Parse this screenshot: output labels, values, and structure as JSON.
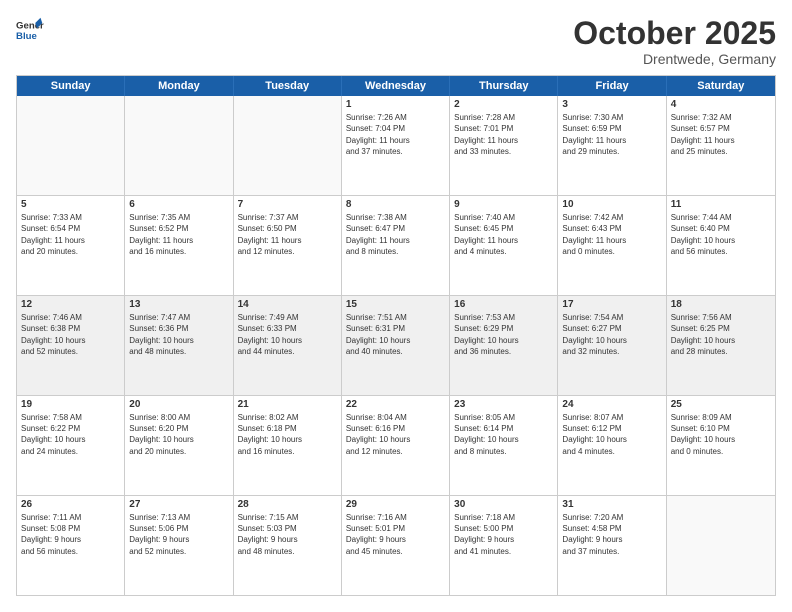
{
  "logo": {
    "line1": "General",
    "line2": "Blue"
  },
  "title": "October 2025",
  "subtitle": "Drentwede, Germany",
  "days": [
    "Sunday",
    "Monday",
    "Tuesday",
    "Wednesday",
    "Thursday",
    "Friday",
    "Saturday"
  ],
  "rows": [
    [
      {
        "day": "",
        "text": "",
        "empty": true
      },
      {
        "day": "",
        "text": "",
        "empty": true
      },
      {
        "day": "",
        "text": "",
        "empty": true
      },
      {
        "day": "1",
        "text": "Sunrise: 7:26 AM\nSunset: 7:04 PM\nDaylight: 11 hours\nand 37 minutes."
      },
      {
        "day": "2",
        "text": "Sunrise: 7:28 AM\nSunset: 7:01 PM\nDaylight: 11 hours\nand 33 minutes."
      },
      {
        "day": "3",
        "text": "Sunrise: 7:30 AM\nSunset: 6:59 PM\nDaylight: 11 hours\nand 29 minutes."
      },
      {
        "day": "4",
        "text": "Sunrise: 7:32 AM\nSunset: 6:57 PM\nDaylight: 11 hours\nand 25 minutes."
      }
    ],
    [
      {
        "day": "5",
        "text": "Sunrise: 7:33 AM\nSunset: 6:54 PM\nDaylight: 11 hours\nand 20 minutes."
      },
      {
        "day": "6",
        "text": "Sunrise: 7:35 AM\nSunset: 6:52 PM\nDaylight: 11 hours\nand 16 minutes."
      },
      {
        "day": "7",
        "text": "Sunrise: 7:37 AM\nSunset: 6:50 PM\nDaylight: 11 hours\nand 12 minutes."
      },
      {
        "day": "8",
        "text": "Sunrise: 7:38 AM\nSunset: 6:47 PM\nDaylight: 11 hours\nand 8 minutes."
      },
      {
        "day": "9",
        "text": "Sunrise: 7:40 AM\nSunset: 6:45 PM\nDaylight: 11 hours\nand 4 minutes."
      },
      {
        "day": "10",
        "text": "Sunrise: 7:42 AM\nSunset: 6:43 PM\nDaylight: 11 hours\nand 0 minutes."
      },
      {
        "day": "11",
        "text": "Sunrise: 7:44 AM\nSunset: 6:40 PM\nDaylight: 10 hours\nand 56 minutes."
      }
    ],
    [
      {
        "day": "12",
        "text": "Sunrise: 7:46 AM\nSunset: 6:38 PM\nDaylight: 10 hours\nand 52 minutes.",
        "shaded": true
      },
      {
        "day": "13",
        "text": "Sunrise: 7:47 AM\nSunset: 6:36 PM\nDaylight: 10 hours\nand 48 minutes.",
        "shaded": true
      },
      {
        "day": "14",
        "text": "Sunrise: 7:49 AM\nSunset: 6:33 PM\nDaylight: 10 hours\nand 44 minutes.",
        "shaded": true
      },
      {
        "day": "15",
        "text": "Sunrise: 7:51 AM\nSunset: 6:31 PM\nDaylight: 10 hours\nand 40 minutes.",
        "shaded": true
      },
      {
        "day": "16",
        "text": "Sunrise: 7:53 AM\nSunset: 6:29 PM\nDaylight: 10 hours\nand 36 minutes.",
        "shaded": true
      },
      {
        "day": "17",
        "text": "Sunrise: 7:54 AM\nSunset: 6:27 PM\nDaylight: 10 hours\nand 32 minutes.",
        "shaded": true
      },
      {
        "day": "18",
        "text": "Sunrise: 7:56 AM\nSunset: 6:25 PM\nDaylight: 10 hours\nand 28 minutes.",
        "shaded": true
      }
    ],
    [
      {
        "day": "19",
        "text": "Sunrise: 7:58 AM\nSunset: 6:22 PM\nDaylight: 10 hours\nand 24 minutes."
      },
      {
        "day": "20",
        "text": "Sunrise: 8:00 AM\nSunset: 6:20 PM\nDaylight: 10 hours\nand 20 minutes."
      },
      {
        "day": "21",
        "text": "Sunrise: 8:02 AM\nSunset: 6:18 PM\nDaylight: 10 hours\nand 16 minutes."
      },
      {
        "day": "22",
        "text": "Sunrise: 8:04 AM\nSunset: 6:16 PM\nDaylight: 10 hours\nand 12 minutes."
      },
      {
        "day": "23",
        "text": "Sunrise: 8:05 AM\nSunset: 6:14 PM\nDaylight: 10 hours\nand 8 minutes."
      },
      {
        "day": "24",
        "text": "Sunrise: 8:07 AM\nSunset: 6:12 PM\nDaylight: 10 hours\nand 4 minutes."
      },
      {
        "day": "25",
        "text": "Sunrise: 8:09 AM\nSunset: 6:10 PM\nDaylight: 10 hours\nand 0 minutes."
      }
    ],
    [
      {
        "day": "26",
        "text": "Sunrise: 7:11 AM\nSunset: 5:08 PM\nDaylight: 9 hours\nand 56 minutes."
      },
      {
        "day": "27",
        "text": "Sunrise: 7:13 AM\nSunset: 5:06 PM\nDaylight: 9 hours\nand 52 minutes."
      },
      {
        "day": "28",
        "text": "Sunrise: 7:15 AM\nSunset: 5:03 PM\nDaylight: 9 hours\nand 48 minutes."
      },
      {
        "day": "29",
        "text": "Sunrise: 7:16 AM\nSunset: 5:01 PM\nDaylight: 9 hours\nand 45 minutes."
      },
      {
        "day": "30",
        "text": "Sunrise: 7:18 AM\nSunset: 5:00 PM\nDaylight: 9 hours\nand 41 minutes."
      },
      {
        "day": "31",
        "text": "Sunrise: 7:20 AM\nSunset: 4:58 PM\nDaylight: 9 hours\nand 37 minutes."
      },
      {
        "day": "",
        "text": "",
        "empty": true
      }
    ]
  ]
}
